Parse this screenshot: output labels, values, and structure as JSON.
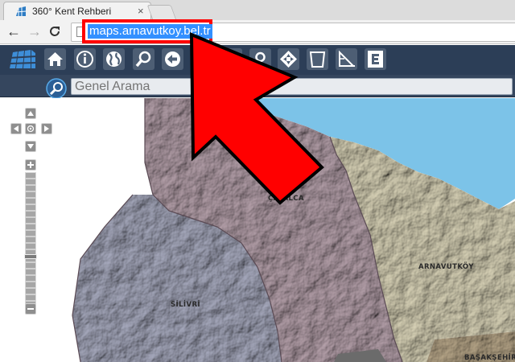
{
  "browser": {
    "tab_title": "360° Kent Rehberi",
    "tab_close": "×",
    "address": "maps.arnavutkoy.bel.tr",
    "back": "←",
    "forward": "→",
    "reload": "C"
  },
  "app": {
    "toolbar_icons": [
      "logo-grid-icon",
      "home-icon",
      "info-icon",
      "globe-icon",
      "zoom-icon",
      "back-arrow-icon",
      "layers-icon",
      "measure-icon",
      "location-pin-icon",
      "pan-icon",
      "select-area-icon",
      "triangle-ruler-icon",
      "export-icon"
    ],
    "search_placeholder": "Genel Arama"
  },
  "map": {
    "labels": {
      "catalca": "ÇATALCA",
      "arnavutkoy": "ARNAVUTKÖY",
      "silivri": "SİLİVRİ",
      "basaksehir": "BAŞAKŞEHİR"
    },
    "colors": {
      "sea": "#7cc3e8",
      "catalca": "#b8a3ad",
      "silivri": "#a9acc0",
      "arnavutkoy": "#dcd6ba"
    }
  },
  "annotation": {
    "arrow_color": "#ff0000",
    "highlight_color": "#ff0000"
  }
}
